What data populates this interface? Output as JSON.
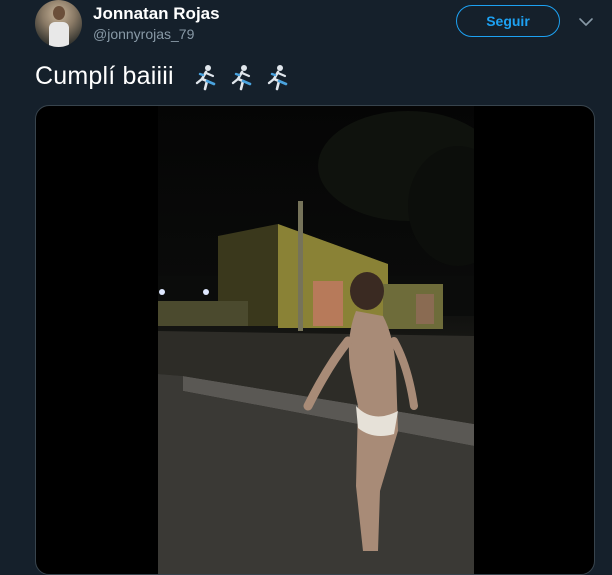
{
  "user": {
    "display_name": "Jonnatan Rojas",
    "handle": "@jonnyrojas_79"
  },
  "follow_label": "Seguir",
  "tweet": {
    "text": "Cumplí baiiii",
    "emoji_icons": [
      "runner-icon",
      "runner-icon",
      "runner-icon"
    ]
  },
  "colors": {
    "background": "#15202b",
    "accent": "#1da1f2",
    "secondary_text": "#8899a6"
  }
}
